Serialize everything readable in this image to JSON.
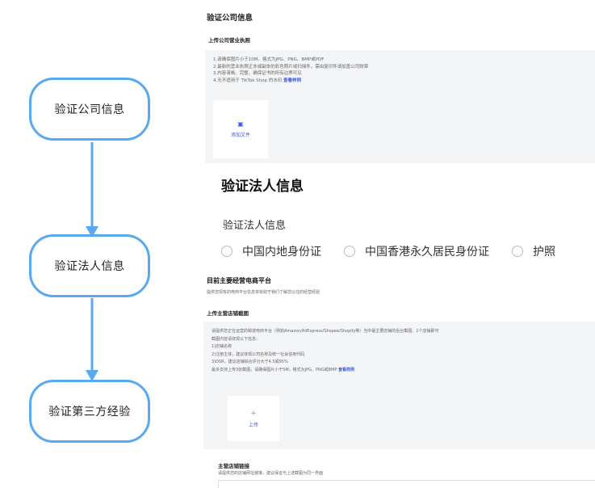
{
  "flow": {
    "nodes": [
      {
        "label": "验证公司信息"
      },
      {
        "label": "验证法人信息"
      },
      {
        "label": "验证第三方经验"
      }
    ],
    "colors": {
      "border": "#58a9f0",
      "arrow": "#58a9f0"
    }
  },
  "form": {
    "section1": {
      "title": "验证公司信息",
      "subtitle": "上传公司营业执照",
      "notes": [
        "1.请确保图片小于10M，格式为JPG、PNG、BMP或PDF",
        "2.最新的营业执照正本或副本的彩色照片或扫描件，需由复印件请加盖公司财章",
        "3.内容清晰、完整，确保证书的所有边界可见",
        "4.无不适用于 TikTok Shop 的水印"
      ],
      "notes_link": "查看样例",
      "upload_label": "添加文件"
    },
    "section2": {
      "title": "验证法人信息",
      "subtitle": "验证法人信息",
      "options": [
        "中国内地身份证",
        "中国香港永久居民身份证",
        "护照"
      ]
    },
    "section3": {
      "title": "目前主要经营电商平台",
      "desc": "提供您现有的电商平台信息将有助于我们了解您以往的经营经验",
      "subtitle": "上传主营店铺截图",
      "notes": [
        "请提供您正在运营的跨境电商平台（例如Amazon/AliExpress/Shopee/Shopify等）当中最主要店铺的后台截图，1个店铺即可",
        "截图内容请体现以下信息：",
        "1)店铺名称",
        "2)注册主体，建议体现公司名称及统一社会信用代码",
        "3)DSR，建议店铺综合评分大于4.5或95%",
        "最多支持上传3张截图，请确保图片小于5M，格式为JPG、PNG或BMP"
      ],
      "notes_link": "查看样例",
      "upload_label": "上传",
      "link_title": "主营店铺链接",
      "link_desc": "请提供您的店铺网址链接，建议保证与上述截图为同一界面"
    }
  }
}
